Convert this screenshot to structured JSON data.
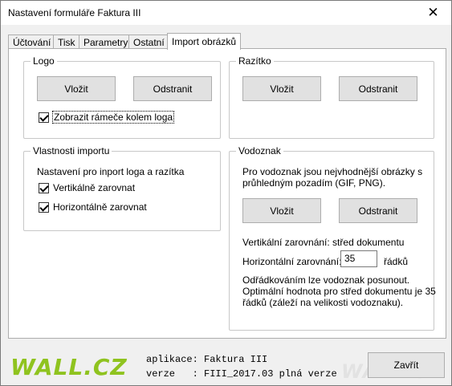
{
  "window": {
    "title": "Nastavení formuláře Faktura III",
    "close_glyph": "✕"
  },
  "tabs": [
    {
      "label": "Účtování"
    },
    {
      "label": "Tisk"
    },
    {
      "label": "Parametry"
    },
    {
      "label": "Ostatní"
    },
    {
      "label": "Import obrázků"
    }
  ],
  "logo_group": {
    "legend": "Logo",
    "insert_label": "Vložit",
    "remove_label": "Odstranit",
    "show_frames_label": "Zobrazit rámeče kolem loga",
    "show_frames_checked": true
  },
  "stamp_group": {
    "legend": "Razítko",
    "insert_label": "Vložit",
    "remove_label": "Odstranit"
  },
  "import_props": {
    "legend": "Vlastnosti importu",
    "description": "Nastavení pro inport loga a razítka",
    "vertical_label": "Vertikálně zarovnat",
    "vertical_checked": true,
    "horizontal_label": "Horizontálně zarovnat",
    "horizontal_checked": true
  },
  "watermark_group": {
    "legend": "Vodoznak",
    "intro_line1": "Pro vodoznak jsou nejvhodnější obrázky s",
    "intro_line2": "průhledným pozadím (GIF, PNG).",
    "insert_label": "Vložit",
    "remove_label": "Odstranit",
    "vertical_alignment": "Vertikální zarovnání: střed dokumentu",
    "horizontal_alignment_label": "Horizontální zarovnání:",
    "horizontal_alignment_value": "35",
    "rows_unit": "řádků",
    "note_line1": "Odřádkováním lze vodoznak posunout.",
    "note_line2": "Optimální hodnota pro střed dokumentu je 35",
    "note_line3": "řádků (záleží na velikosti vodoznaku)."
  },
  "footer": {
    "logo_text": "WALL.CZ",
    "app_line": "aplikace: Faktura III",
    "version_line": "verze   : FIII_2017.03 plná verze",
    "close_label": "Zavřít",
    "watermark_text": "WALL.CZ"
  },
  "colors": {
    "logo_green": "#8fc31f"
  }
}
